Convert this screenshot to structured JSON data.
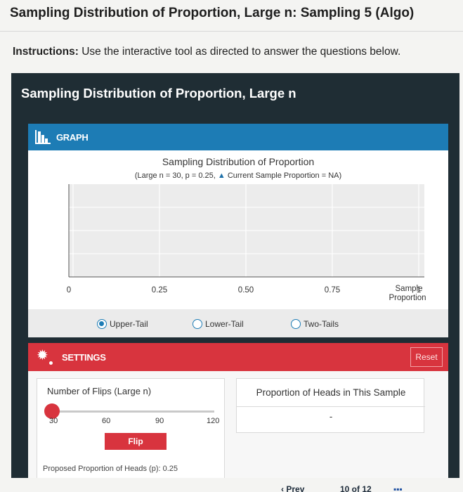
{
  "page": {
    "title": "Sampling Distribution of Proportion, Large n: Sampling 5 (Algo)",
    "instructions_label": "Instructions:",
    "instructions_text": "Use the interactive tool as directed to answer the questions below."
  },
  "tool": {
    "title": "Sampling Distribution of Proportion, Large n",
    "graph_label": "GRAPH",
    "settings_label": "SETTINGS",
    "reset_label": "Reset"
  },
  "chart_data": {
    "type": "bar",
    "title": "Sampling Distribution of Proportion",
    "subtitle_prefix": "(Large n = 30, p = 0.25,",
    "subtitle_marker": "▲",
    "subtitle_suffix": "Current Sample Proportion = NA)",
    "xlabel": "Sample Proportion",
    "xlabel_line1": "Sample",
    "xlabel_line2": "Proportion",
    "xlim": [
      0,
      1
    ],
    "ticks": [
      {
        "value": 0,
        "label": "0"
      },
      {
        "value": 0.25,
        "label": "0.25"
      },
      {
        "value": 0.5,
        "label": "0.50"
      },
      {
        "value": 0.75,
        "label": "0.75"
      },
      {
        "value": 1,
        "label": "1"
      }
    ],
    "values": [],
    "grid": true
  },
  "tails": [
    {
      "label": "Upper-Tail",
      "selected": true
    },
    {
      "label": "Lower-Tail",
      "selected": false
    },
    {
      "label": "Two-Tails",
      "selected": false
    }
  ],
  "settings": {
    "flips_label": "Number of Flips (Large n)",
    "slider_value": 30,
    "slider_ticks": [
      "30",
      "60",
      "90",
      "120"
    ],
    "flip_button": "Flip",
    "proposed_label": "Proposed Proportion of Heads (p): 0.25",
    "heads_label": "Proportion of Heads in This Sample",
    "heads_value": "-"
  },
  "bottom_nav": {
    "prev_label": "Prev",
    "page_indicator": "10 of 12"
  },
  "colors": {
    "graph_header": "#1d7cb5",
    "settings_header": "#d8343e",
    "tool_bg": "#1f2d34"
  }
}
